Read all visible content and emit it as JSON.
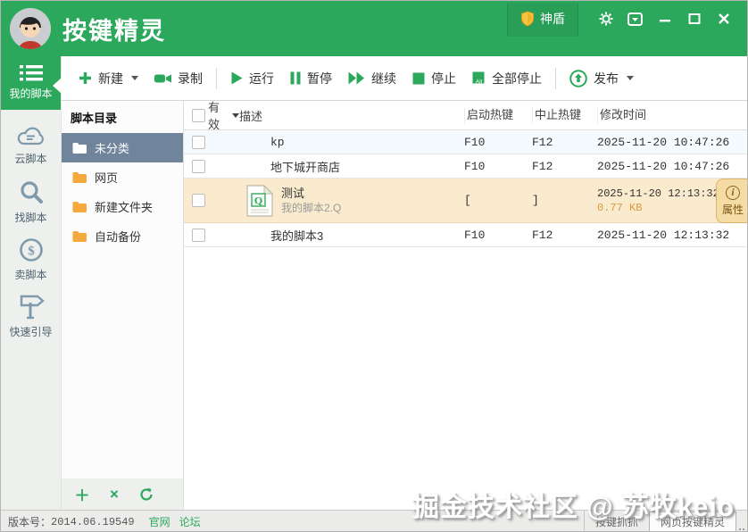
{
  "titlebar": {
    "app_title": "按键精灵",
    "shield_label": "神盾"
  },
  "toolbar": {
    "new": "新建",
    "record": "录制",
    "run": "运行",
    "pause": "暂停",
    "resume": "继续",
    "stop": "停止",
    "stop_all": "全部停止",
    "publish": "发布"
  },
  "sidebar": {
    "items": [
      {
        "label": "我的脚本",
        "active": true
      },
      {
        "label": "云脚本"
      },
      {
        "label": "找脚本"
      },
      {
        "label": "卖脚本"
      },
      {
        "label": "快速引导"
      }
    ]
  },
  "directory": {
    "title": "脚本目录",
    "folders": [
      {
        "label": "未分类",
        "selected": true
      },
      {
        "label": "网页"
      },
      {
        "label": "新建文件夹"
      },
      {
        "label": "自动备份"
      }
    ]
  },
  "table": {
    "headers": {
      "valid": "有效",
      "desc": "描述",
      "start_hotkey": "启动热键",
      "stop_hotkey": "中止热键",
      "modified": "修改时间"
    },
    "rows": [
      {
        "desc": "kp",
        "start": "F10",
        "stop": "F12",
        "modified": "2025-11-20 10:47:26"
      },
      {
        "desc": "地下城开商店",
        "start": "F10",
        "stop": "F12",
        "modified": "2025-11-20 10:47:26"
      },
      {
        "desc": "测试",
        "file": "我的脚本2.Q",
        "start": "[",
        "stop": "]",
        "modified": "2025-11-20 12:13:32",
        "size": "0.77 KB",
        "selected": true
      },
      {
        "desc": "我的脚本3",
        "start": "F10",
        "stop": "F12",
        "modified": "2025-11-20 12:13:32"
      }
    ],
    "properties_tab": "属性"
  },
  "statusbar": {
    "version_label": "版本号：",
    "version": "2014.06.19549",
    "links": [
      "官网",
      "论坛"
    ],
    "buttons": [
      "按键抓抓",
      "网页按键精灵"
    ]
  },
  "watermark": "掘金技术社区 @ 苏牧keio",
  "colors": {
    "brand_green": "#2BA85C",
    "selected_row": "#FBEBCE",
    "selected_folder": "#70849B",
    "folder_orange": "#F5A83C",
    "size_orange": "#D9983F"
  }
}
